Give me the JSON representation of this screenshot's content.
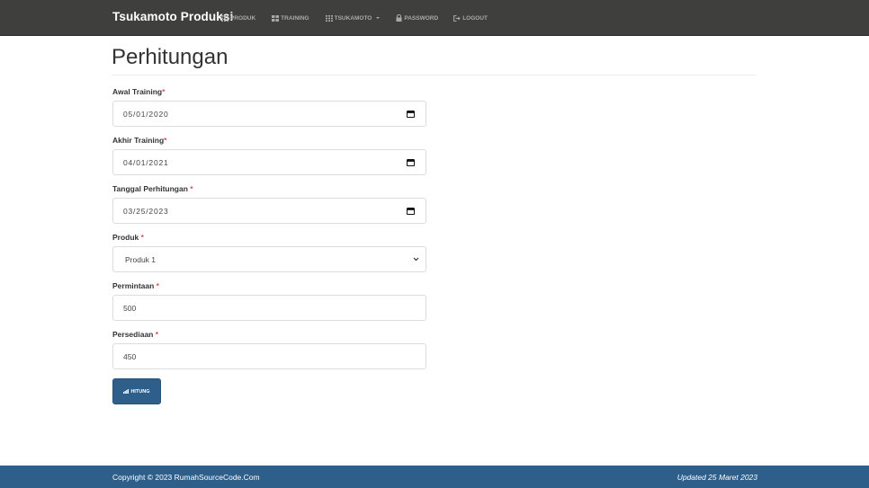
{
  "navbar": {
    "brand": "Tsukamoto Produksi",
    "items": [
      {
        "label": "PRODUK",
        "icon": "grid-icon"
      },
      {
        "label": "TRAINING",
        "icon": "table-icon"
      },
      {
        "label": "TSUKAMOTO",
        "icon": "grid-icon",
        "dropdown": true
      },
      {
        "label": "PASSWORD",
        "icon": "lock-icon"
      },
      {
        "label": "LOGOUT",
        "icon": "logout-icon"
      }
    ],
    "bg_color": "#3f3f3d"
  },
  "main": {
    "title": "Perhitungan",
    "fields": [
      {
        "label": "Awal Training",
        "required": "*",
        "value": "05/01/2020",
        "type": "date"
      },
      {
        "label": "Akhir Training",
        "required": "*",
        "value": "04/01/2021",
        "type": "date"
      },
      {
        "label": "Tanggal Perhitungan ",
        "required": "*",
        "value": "03/25/2023",
        "type": "date"
      },
      {
        "label": "Produk ",
        "required": "*",
        "value": "Produk 1",
        "type": "select"
      },
      {
        "label": "Permintaan ",
        "required": "*",
        "value": "500",
        "type": "text"
      },
      {
        "label": "Persediaan ",
        "required": "*",
        "value": "450",
        "type": "text"
      }
    ],
    "submit_label": "HITUNG",
    "submit_icon": "bar-chart-icon",
    "accent_color": "#2e5f8a",
    "required_color": "#d9534f"
  },
  "footer": {
    "copyright": "Copyright © 2023 RumahSourceCode.Com",
    "updated": "Updated 25 Maret 2023"
  }
}
